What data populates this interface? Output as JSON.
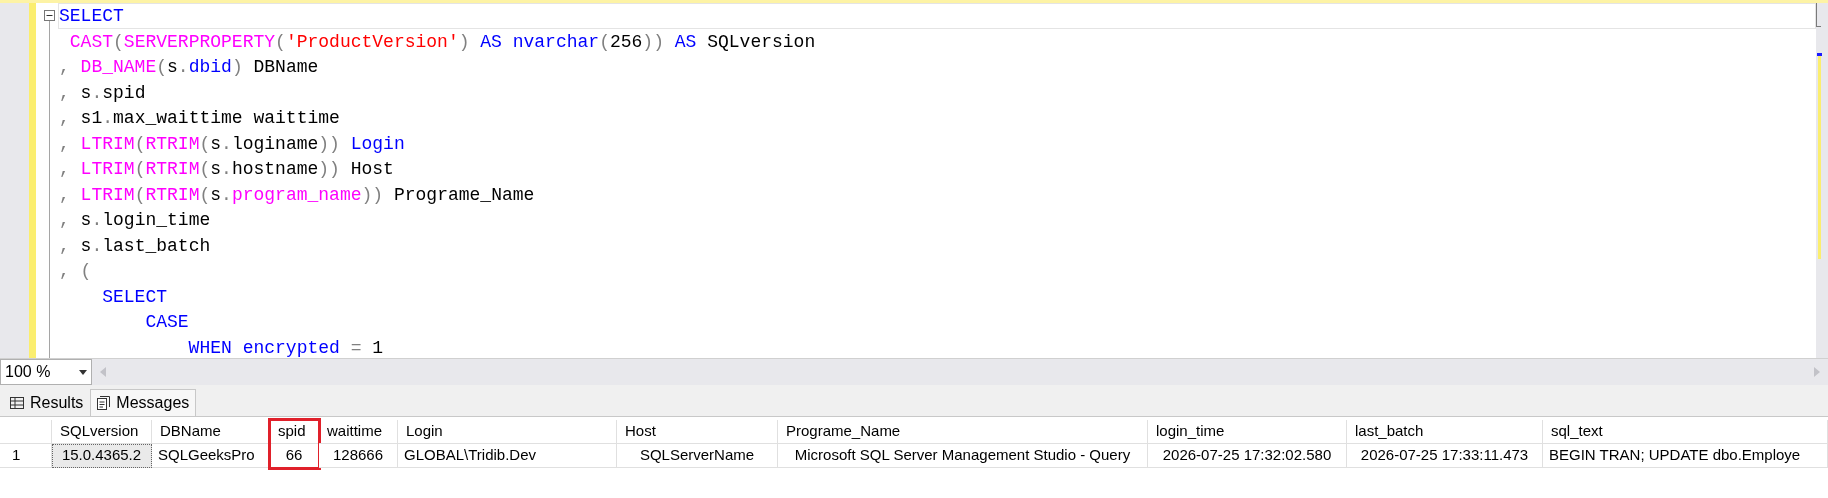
{
  "editor": {
    "lines": [
      {
        "current": true,
        "tokens": [
          {
            "kind": "kw",
            "text": "SELECT"
          }
        ]
      },
      {
        "current": false,
        "tokens": [
          {
            "kind": "fn",
            "text": " CAST"
          },
          {
            "kind": "op",
            "text": "("
          },
          {
            "kind": "fn",
            "text": "SERVERPROPERTY"
          },
          {
            "kind": "op",
            "text": "("
          },
          {
            "kind": "str",
            "text": "'ProductVersion'"
          },
          {
            "kind": "op",
            "text": ") "
          },
          {
            "kind": "kw",
            "text": "AS nvarchar"
          },
          {
            "kind": "op",
            "text": "("
          },
          {
            "kind": "plain",
            "text": "256"
          },
          {
            "kind": "op",
            "text": ")) "
          },
          {
            "kind": "kw",
            "text": "AS"
          },
          {
            "kind": "plain",
            "text": " SQLversion"
          }
        ]
      },
      {
        "current": false,
        "tokens": [
          {
            "kind": "op",
            "text": ", "
          },
          {
            "kind": "fn",
            "text": "DB_NAME"
          },
          {
            "kind": "op",
            "text": "("
          },
          {
            "kind": "plain",
            "text": "s"
          },
          {
            "kind": "op",
            "text": "."
          },
          {
            "kind": "kw",
            "text": "dbid"
          },
          {
            "kind": "op",
            "text": ") "
          },
          {
            "kind": "plain",
            "text": "DBName"
          }
        ]
      },
      {
        "current": false,
        "tokens": [
          {
            "kind": "op",
            "text": ", "
          },
          {
            "kind": "plain",
            "text": "s"
          },
          {
            "kind": "op",
            "text": "."
          },
          {
            "kind": "plain",
            "text": "spid"
          }
        ]
      },
      {
        "current": false,
        "tokens": [
          {
            "kind": "op",
            "text": ", "
          },
          {
            "kind": "plain",
            "text": "s1"
          },
          {
            "kind": "op",
            "text": "."
          },
          {
            "kind": "plain",
            "text": "max_waittime waittime"
          }
        ]
      },
      {
        "current": false,
        "tokens": [
          {
            "kind": "op",
            "text": ", "
          },
          {
            "kind": "fn",
            "text": "LTRIM"
          },
          {
            "kind": "op",
            "text": "("
          },
          {
            "kind": "fn",
            "text": "RTRIM"
          },
          {
            "kind": "op",
            "text": "("
          },
          {
            "kind": "plain",
            "text": "s"
          },
          {
            "kind": "op",
            "text": "."
          },
          {
            "kind": "plain",
            "text": "loginame"
          },
          {
            "kind": "op",
            "text": ")) "
          },
          {
            "kind": "kw",
            "text": "Login"
          }
        ]
      },
      {
        "current": false,
        "tokens": [
          {
            "kind": "op",
            "text": ", "
          },
          {
            "kind": "fn",
            "text": "LTRIM"
          },
          {
            "kind": "op",
            "text": "("
          },
          {
            "kind": "fn",
            "text": "RTRIM"
          },
          {
            "kind": "op",
            "text": "("
          },
          {
            "kind": "plain",
            "text": "s"
          },
          {
            "kind": "op",
            "text": "."
          },
          {
            "kind": "plain",
            "text": "hostname"
          },
          {
            "kind": "op",
            "text": ")) "
          },
          {
            "kind": "plain",
            "text": "Host"
          }
        ]
      },
      {
        "current": false,
        "tokens": [
          {
            "kind": "op",
            "text": ", "
          },
          {
            "kind": "fn",
            "text": "LTRIM"
          },
          {
            "kind": "op",
            "text": "("
          },
          {
            "kind": "fn",
            "text": "RTRIM"
          },
          {
            "kind": "op",
            "text": "("
          },
          {
            "kind": "plain",
            "text": "s"
          },
          {
            "kind": "op",
            "text": "."
          },
          {
            "kind": "fn",
            "text": "program_name"
          },
          {
            "kind": "op",
            "text": ")) "
          },
          {
            "kind": "plain",
            "text": "Programe_Name"
          }
        ]
      },
      {
        "current": false,
        "tokens": [
          {
            "kind": "op",
            "text": ", "
          },
          {
            "kind": "plain",
            "text": "s"
          },
          {
            "kind": "op",
            "text": "."
          },
          {
            "kind": "plain",
            "text": "login_time"
          }
        ]
      },
      {
        "current": false,
        "tokens": [
          {
            "kind": "op",
            "text": ", "
          },
          {
            "kind": "plain",
            "text": "s"
          },
          {
            "kind": "op",
            "text": "."
          },
          {
            "kind": "plain",
            "text": "last_batch"
          }
        ]
      },
      {
        "current": false,
        "tokens": [
          {
            "kind": "op",
            "text": ", ("
          }
        ]
      },
      {
        "current": false,
        "tokens": [
          {
            "kind": "kw",
            "text": "    SELECT"
          }
        ]
      },
      {
        "current": false,
        "tokens": [
          {
            "kind": "kw",
            "text": "        CASE"
          }
        ]
      },
      {
        "current": false,
        "tokens": [
          {
            "kind": "kw",
            "text": "            WHEN encrypted"
          },
          {
            "kind": "op",
            "text": " = "
          },
          {
            "kind": "plain",
            "text": "1"
          }
        ]
      }
    ]
  },
  "zoom": {
    "value": "100 %"
  },
  "tabs": [
    {
      "label": "Results",
      "kind": "grid",
      "selected": true
    },
    {
      "label": "Messages",
      "kind": "messages",
      "selected": false
    }
  ],
  "grid": {
    "columns": [
      {
        "label": "SQLversion",
        "highlighted": false
      },
      {
        "label": "DBName",
        "highlighted": false
      },
      {
        "label": "spid",
        "highlighted": true
      },
      {
        "label": "waittime",
        "highlighted": false
      },
      {
        "label": "Login",
        "highlighted": false
      },
      {
        "label": "Host",
        "highlighted": false
      },
      {
        "label": "Programe_Name",
        "highlighted": false
      },
      {
        "label": "login_time",
        "highlighted": false
      },
      {
        "label": "last_batch",
        "highlighted": false
      },
      {
        "label": "sql_text",
        "highlighted": false
      }
    ],
    "rows": [
      {
        "number": "1",
        "cells": [
          {
            "text": "15.0.4365.2",
            "selected": true
          },
          {
            "text": "SQLGeeksPro",
            "selected": false
          },
          {
            "text": "66",
            "selected": false
          },
          {
            "text": "128666",
            "selected": false
          },
          {
            "text": "GLOBAL\\Tridib.Dev",
            "selected": false
          },
          {
            "text": "SQLServerName",
            "selected": false
          },
          {
            "text": "Microsoft SQL Server Management Studio - Query",
            "selected": false
          },
          {
            "text": "2026-07-25 17:32:02.580",
            "selected": false
          },
          {
            "text": "2026-07-25 17:33:11.473",
            "selected": false
          },
          {
            "text": "BEGIN TRAN; UPDATE dbo.Employe",
            "selected": false
          }
        ]
      }
    ]
  }
}
